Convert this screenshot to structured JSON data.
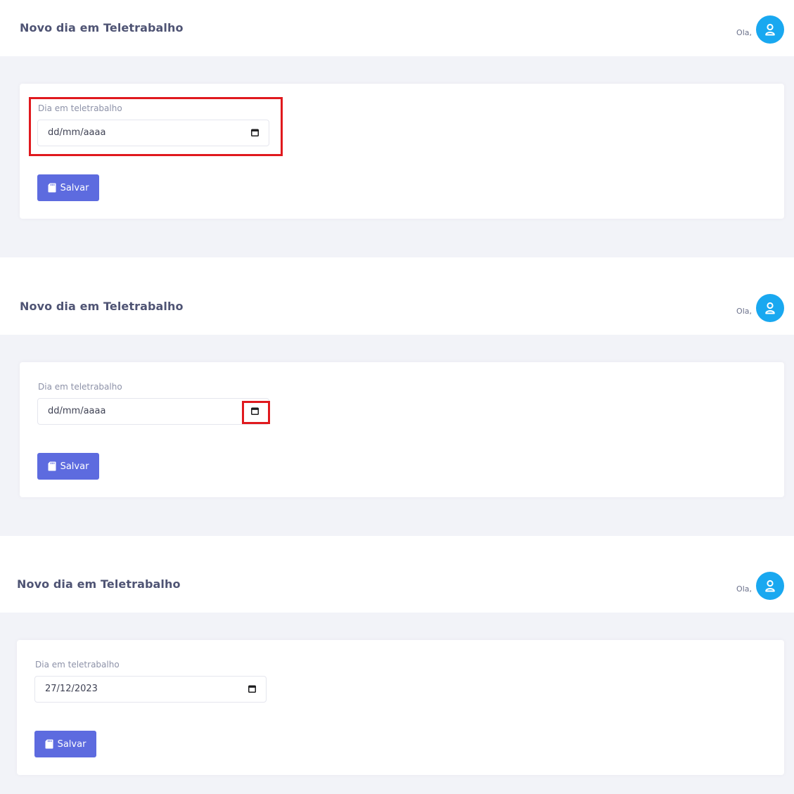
{
  "header": {
    "title": "Novo dia em Teletrabalho",
    "greeting": "Ola,"
  },
  "form": {
    "field_label": "Dia em teletrabalho",
    "save_label": "Salvar"
  },
  "steps": [
    {
      "date_value": "dd/mm/aaaa"
    },
    {
      "date_value": "dd/mm/aaaa"
    },
    {
      "date_value": "27/12/2023"
    }
  ],
  "colors": {
    "accent": "#5d6bdf",
    "avatar": "#19a8f0",
    "highlight": "#e0191e",
    "background": "#f2f3f8"
  },
  "icons": [
    "user-icon",
    "calendar-icon",
    "save-icon"
  ]
}
